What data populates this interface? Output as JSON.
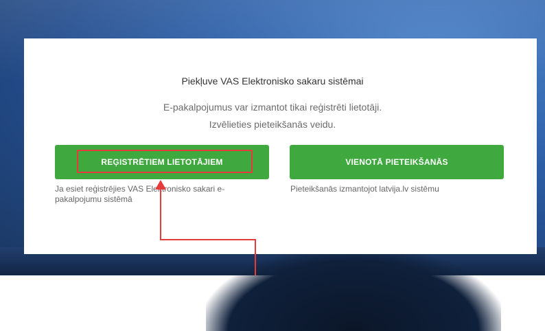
{
  "card": {
    "title": "Piekļuve VAS Elektronisko sakaru sistēmai",
    "subtitle_line1": "E-pakalpojumus var izmantot tikai reģistrēti lietotāji.",
    "subtitle_line2": "Izvēlieties pieteikšanās veidu."
  },
  "options": [
    {
      "button_label": "REĢISTRĒTIEM LIETOTĀJIEM",
      "description": "Ja esiet reģistrējies VAS Elektronisko sakari e-pakalpojumu sistēmā"
    },
    {
      "button_label": "VIENOTĀ PIETEIKŠANĀS",
      "description": "Pieteikšanās izmantojot latvija.lv sistēmu"
    }
  ],
  "colors": {
    "button": "#3fa93f",
    "annotation": "#e53b3b"
  }
}
